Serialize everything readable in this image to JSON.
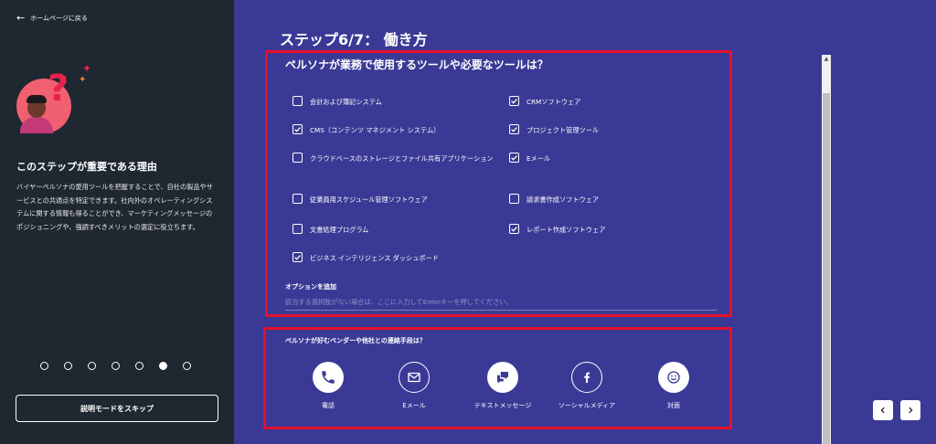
{
  "sidebar": {
    "back_label": "ホームページに戻る",
    "title": "このステップが重要である理由",
    "description": "バイヤーペルソナの愛用ツールを把握することで、自社の製品やサービスとの共通点を特定できます。社内外のオペレーティングシステムに関する情報も得ることができ、マーケティングメッセージのポジショニングや、強調すべきメリットの選定に役立ちます。",
    "skip_label": "説明モードをスキップ",
    "progress": {
      "total": 7,
      "current": 6
    }
  },
  "main": {
    "step_title": "ステップ6/7： 働き方",
    "tools_question": "ペルソナが業務で使用するツールや必要なツールは？",
    "tools": [
      {
        "label": "会計および簿記システム",
        "checked": false
      },
      {
        "label": "CRMソフトウェア",
        "checked": true
      },
      {
        "label": "CMS（コンテンツ マネジメント システム）",
        "checked": true
      },
      {
        "label": "プロジェクト管理ツール",
        "checked": true
      },
      {
        "label": "クラウドベースのストレージとファイル共有アプリケーション",
        "checked": false
      },
      {
        "label": "Eメール",
        "checked": true
      },
      {
        "label": "従業員用スケジュール管理ソフトウェア",
        "checked": false
      },
      {
        "label": "請求書作成ソフトウェア",
        "checked": false
      },
      {
        "label": "文書処理プログラム",
        "checked": false
      },
      {
        "label": "レポート作成ソフトウェア",
        "checked": true
      },
      {
        "label": "ビジネス インテリジェンス ダッシュボード",
        "checked": true
      }
    ],
    "add_option_label": "オプションを追加",
    "add_option_placeholder": "該当する選択肢がない場合は、ここに入力してEnterキーを押してください。",
    "contact_question": "ペルソナが好むベンダーや他社との連絡手段は？",
    "contacts": [
      {
        "label": "電話",
        "icon": "phone-icon",
        "selected": true
      },
      {
        "label": "Eメール",
        "icon": "envelope-icon",
        "selected": false
      },
      {
        "label": "テキストメッセージ",
        "icon": "chat-icon",
        "selected": true
      },
      {
        "label": "ソーシャルメディア",
        "icon": "facebook-icon",
        "selected": false
      },
      {
        "label": "対面",
        "icon": "smiley-icon",
        "selected": true
      }
    ]
  },
  "colors": {
    "background": "#3a3a96",
    "sidebar": "#1f2731",
    "highlight_border": "#e5102a"
  }
}
